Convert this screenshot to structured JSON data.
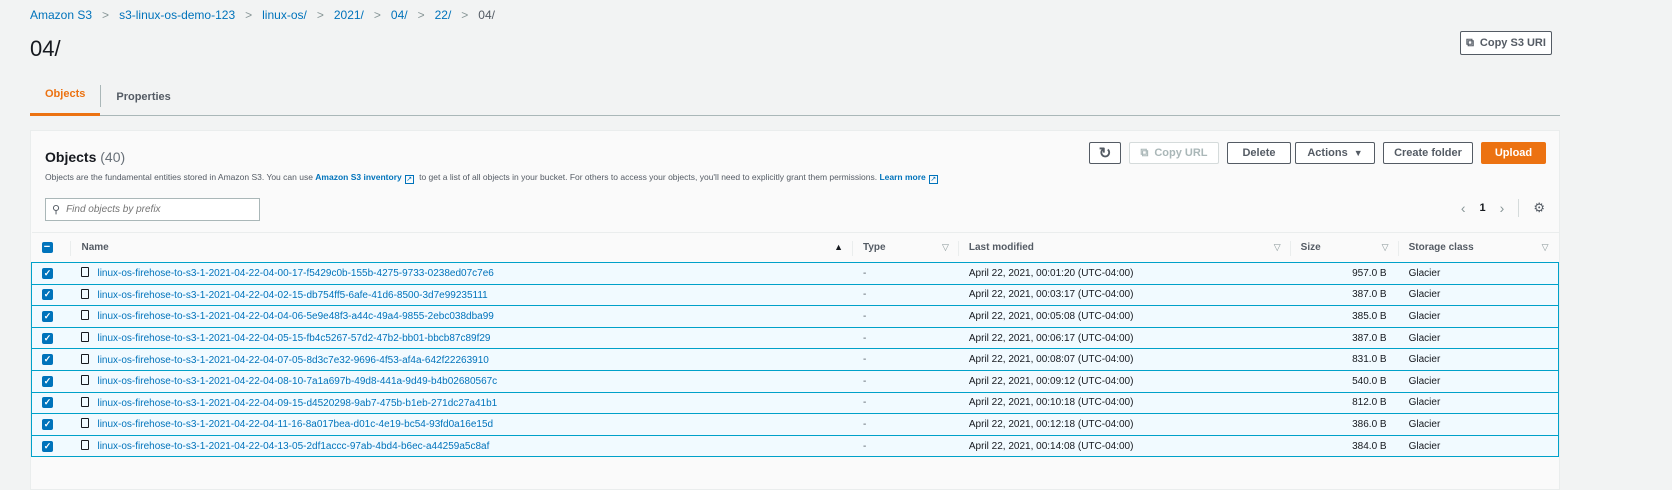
{
  "breadcrumb": [
    "Amazon S3",
    "s3-linux-os-demo-123",
    "linux-os/",
    "2021/",
    "04/",
    "22/",
    "04/"
  ],
  "page_title": "04/",
  "copy_s3_uri": "Copy S3 URI",
  "tabs": [
    "Objects",
    "Properties"
  ],
  "objects": {
    "title": "Objects",
    "count": "(40)",
    "desc_1": "Objects are the fundamental entities stored in Amazon S3. You can use ",
    "desc_link": "Amazon S3 inventory",
    "desc_2": " to get a list of all objects in your bucket. For others to access your objects, you'll need to explicitly grant them permissions. ",
    "learn_more": "Learn more",
    "buttons": {
      "copy_url": "Copy URL",
      "delete": "Delete",
      "actions": "Actions",
      "create_folder": "Create folder",
      "upload": "Upload"
    },
    "search_placeholder": "Find objects by prefix",
    "page": "1",
    "columns": [
      "Name",
      "Type",
      "Last modified",
      "Size",
      "Storage class"
    ],
    "rows": [
      {
        "name": "linux-os-firehose-to-s3-1-2021-04-22-04-00-17-f5429c0b-155b-4275-9733-0238ed07c7e6",
        "type": "-",
        "modified": "April 22, 2021, 00:01:20 (UTC-04:00)",
        "size": "957.0 B",
        "class": "Glacier"
      },
      {
        "name": "linux-os-firehose-to-s3-1-2021-04-22-04-02-15-db754ff5-6afe-41d6-8500-3d7e99235111",
        "type": "-",
        "modified": "April 22, 2021, 00:03:17 (UTC-04:00)",
        "size": "387.0 B",
        "class": "Glacier"
      },
      {
        "name": "linux-os-firehose-to-s3-1-2021-04-22-04-04-06-5e9e48f3-a44c-49a4-9855-2ebc038dba99",
        "type": "-",
        "modified": "April 22, 2021, 00:05:08 (UTC-04:00)",
        "size": "385.0 B",
        "class": "Glacier"
      },
      {
        "name": "linux-os-firehose-to-s3-1-2021-04-22-04-05-15-fb4c5267-57d2-47b2-bb01-bbcb87c89f29",
        "type": "-",
        "modified": "April 22, 2021, 00:06:17 (UTC-04:00)",
        "size": "387.0 B",
        "class": "Glacier"
      },
      {
        "name": "linux-os-firehose-to-s3-1-2021-04-22-04-07-05-8d3c7e32-9696-4f53-af4a-642f22263910",
        "type": "-",
        "modified": "April 22, 2021, 00:08:07 (UTC-04:00)",
        "size": "831.0 B",
        "class": "Glacier"
      },
      {
        "name": "linux-os-firehose-to-s3-1-2021-04-22-04-08-10-7a1a697b-49d8-441a-9d49-b4b02680567c",
        "type": "-",
        "modified": "April 22, 2021, 00:09:12 (UTC-04:00)",
        "size": "540.0 B",
        "class": "Glacier"
      },
      {
        "name": "linux-os-firehose-to-s3-1-2021-04-22-04-09-15-d4520298-9ab7-475b-b1eb-271dc27a41b1",
        "type": "-",
        "modified": "April 22, 2021, 00:10:18 (UTC-04:00)",
        "size": "812.0 B",
        "class": "Glacier"
      },
      {
        "name": "linux-os-firehose-to-s3-1-2021-04-22-04-11-16-8a017bea-d01c-4e19-bc54-93fd0a16e15d",
        "type": "-",
        "modified": "April 22, 2021, 00:12:18 (UTC-04:00)",
        "size": "386.0 B",
        "class": "Glacier"
      },
      {
        "name": "linux-os-firehose-to-s3-1-2021-04-22-04-13-05-2df1accc-97ab-4bd4-b6ec-a44259a5c8af",
        "type": "-",
        "modified": "April 22, 2021, 00:14:08 (UTC-04:00)",
        "size": "384.0 B",
        "class": "Glacier"
      }
    ]
  }
}
